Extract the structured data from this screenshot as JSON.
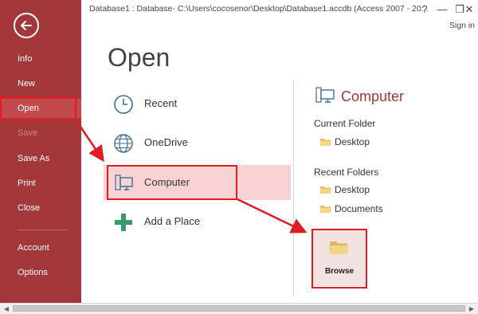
{
  "titlebar": {
    "title": "Database1 : Database- C:\\Users\\cocosenor\\Desktop\\Database1.accdb (Access 2007 - 20...",
    "help_glyph": "?",
    "minimize_glyph": "—",
    "restore_glyph": "❐",
    "close_glyph": "✕",
    "sign_in": "Sign in"
  },
  "backstage": {
    "items": [
      {
        "label": "Info"
      },
      {
        "label": "New"
      },
      {
        "label": "Open"
      },
      {
        "label": "Save"
      },
      {
        "label": "Save As"
      },
      {
        "label": "Print"
      },
      {
        "label": "Close"
      },
      {
        "label": "Account"
      },
      {
        "label": "Options"
      }
    ],
    "accent": "#a4373a"
  },
  "main": {
    "title": "Open",
    "places": [
      {
        "label": "Recent",
        "icon": "clock-icon"
      },
      {
        "label": "OneDrive",
        "icon": "globe-icon"
      },
      {
        "label": "Computer",
        "icon": "computer-icon"
      },
      {
        "label": "Add a Place",
        "icon": "plus-icon"
      }
    ]
  },
  "right": {
    "title": "Computer",
    "current_folder_label": "Current Folder",
    "current_folders": [
      "Desktop"
    ],
    "recent_folders_label": "Recent Folders",
    "recent_folders": [
      "Desktop",
      "Documents"
    ],
    "browse_label": "Browse"
  },
  "scrollbar": {
    "left_glyph": "◀",
    "right_glyph": "▶"
  }
}
